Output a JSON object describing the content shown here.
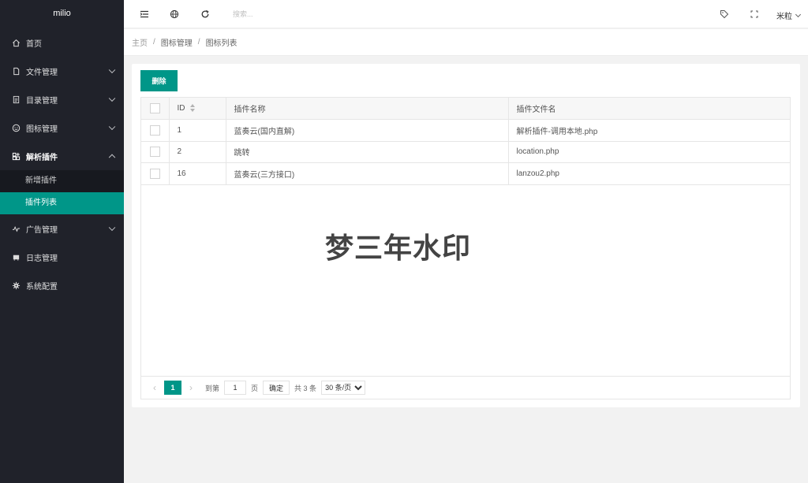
{
  "app": {
    "title": "milio"
  },
  "sidebar": {
    "items": [
      {
        "label": "首页",
        "icon": "home-icon"
      },
      {
        "label": "文件管理",
        "icon": "file-icon"
      },
      {
        "label": "目录管理",
        "icon": "directory-icon"
      },
      {
        "label": "图标管理",
        "icon": "smile-icon"
      },
      {
        "label": "解析插件",
        "icon": "plugin-icon",
        "expanded": true,
        "children": [
          {
            "label": "新增插件"
          },
          {
            "label": "插件列表",
            "active": true
          }
        ]
      },
      {
        "label": "广告管理",
        "icon": "chart-line-icon"
      },
      {
        "label": "日志管理",
        "icon": "log-icon"
      },
      {
        "label": "系统配置",
        "icon": "settings-icon"
      }
    ]
  },
  "header": {
    "search": {
      "placeholder": "搜索..."
    },
    "user": {
      "name": "米粒"
    }
  },
  "breadcrumb": {
    "home": "主页",
    "parent": "图标管理",
    "current": "图标列表"
  },
  "toolbar": {
    "delete_label": "删除"
  },
  "table": {
    "columns": {
      "id": "ID",
      "name": "插件名称",
      "file": "插件文件名"
    },
    "rows": [
      {
        "id": "1",
        "name": "蓝奏云(国内直解)",
        "file": "解析插件-调用本地.php"
      },
      {
        "id": "2",
        "name": "跳转",
        "file": "location.php"
      },
      {
        "id": "16",
        "name": "蓝奏云(三方接口)",
        "file": "lanzou2.php"
      }
    ]
  },
  "watermark": "梦三年水印",
  "pagination": {
    "current": "1",
    "goto_label": "到第",
    "page_input": "1",
    "page_unit": "页",
    "confirm_label": "确定",
    "total_label": "共 3 条",
    "page_size": "30 条/页"
  },
  "colors": {
    "accent": "#009688",
    "sidebar_bg": "#20222a"
  }
}
